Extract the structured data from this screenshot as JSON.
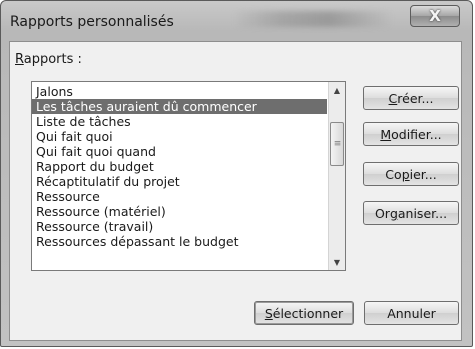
{
  "window": {
    "title": "Rapports personnalisés",
    "close_glyph": "X"
  },
  "list": {
    "label_mnemonic": "R",
    "label_rest": "apports :",
    "items": [
      "Jalons",
      "Les tâches auraient dû commencer",
      "Liste de tâches",
      "Qui fait quoi",
      "Qui fait quoi quand",
      "Rapport du budget",
      "Récaptitulatif du projet",
      "Ressource",
      "Ressource (matériel)",
      "Ressource (travail)",
      "Ressources dépassant le budget"
    ],
    "selected_index": 1
  },
  "buttons": {
    "create": {
      "mnemonic": "C",
      "rest": "réer..."
    },
    "modify": {
      "mnemonic": "M",
      "rest": "odifier..."
    },
    "copy": {
      "pre": "Co",
      "mnemonic": "p",
      "rest": "ier..."
    },
    "organize": {
      "pre": "Or",
      "mnemonic": "g",
      "rest": "aniser..."
    },
    "select": {
      "mnemonic": "S",
      "rest": "électionner"
    },
    "cancel": {
      "label": "Annuler"
    }
  },
  "icons": {
    "close": "close-icon",
    "scroll_up": "arrow-up-icon",
    "scroll_down": "arrow-down-icon",
    "scroll_grip": "grip-icon"
  }
}
